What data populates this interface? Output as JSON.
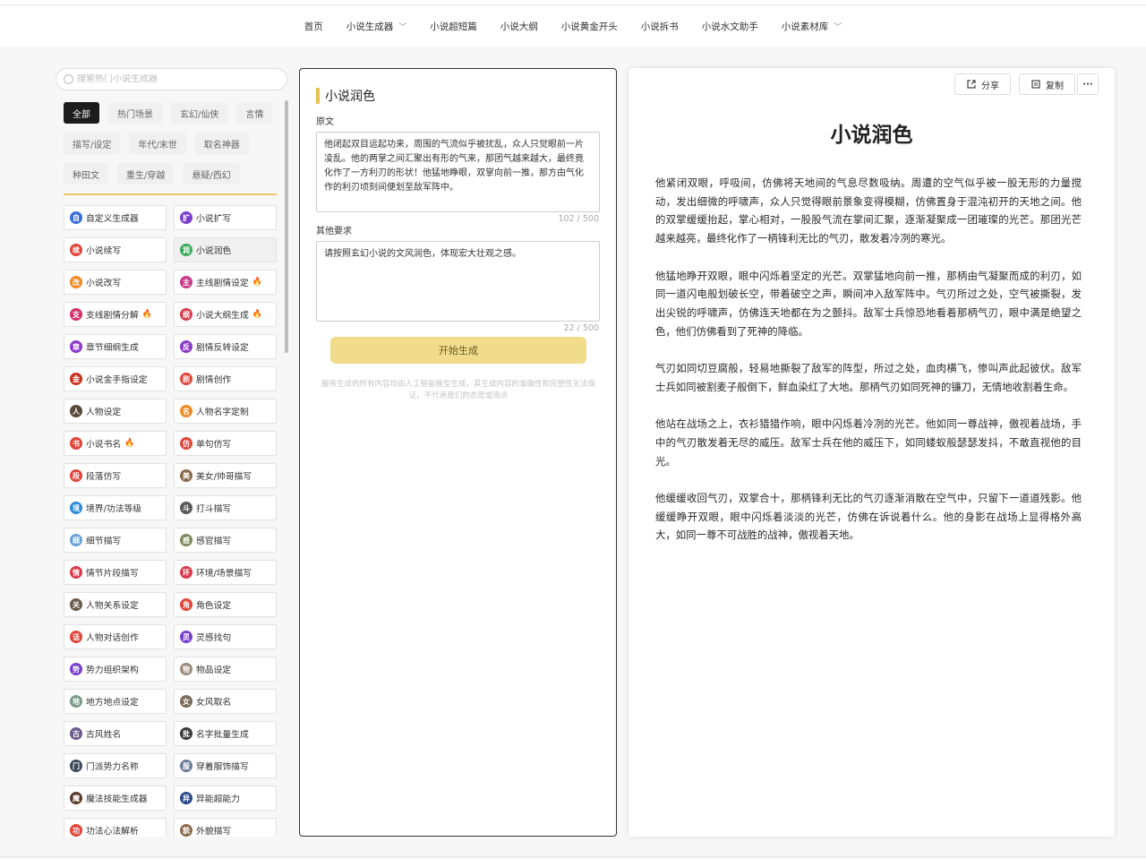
{
  "nav": {
    "items": [
      {
        "label": "首页",
        "dropdown": false
      },
      {
        "label": "小说生成器",
        "dropdown": true
      },
      {
        "label": "小说超短篇",
        "dropdown": false
      },
      {
        "label": "小说大纲",
        "dropdown": false
      },
      {
        "label": "小说黄金开头",
        "dropdown": false
      },
      {
        "label": "小说拆书",
        "dropdown": false
      },
      {
        "label": "小说水文助手",
        "dropdown": false
      },
      {
        "label": "小说素材库",
        "dropdown": true
      }
    ]
  },
  "sidebar": {
    "search_placeholder": "搜索热门小说生成器",
    "categories": [
      [
        "全部",
        "热门场景",
        "玄幻/仙侠",
        "言情"
      ],
      [
        "描写/设定",
        "年代/末世",
        "取名神器"
      ],
      [
        "种田文",
        "重生/穿越",
        "悬疑/西幻"
      ]
    ],
    "active_category": "全部",
    "accent_color": "#e6c76b",
    "tools": [
      {
        "label": "自定义生成器",
        "icon": "自",
        "color": "#3b6fd8",
        "hot": false
      },
      {
        "label": "小说扩写",
        "icon": "扩",
        "color": "#7b3fd0",
        "hot": false
      },
      {
        "label": "小说续写",
        "icon": "续",
        "color": "#e0453a",
        "hot": false
      },
      {
        "label": "小说润色",
        "icon": "润",
        "color": "#3aaa5a",
        "hot": false
      },
      {
        "label": "小说改写",
        "icon": "改",
        "color": "#f08a24",
        "hot": false
      },
      {
        "label": "主线剧情设定",
        "icon": "主",
        "color": "#c83a8a",
        "hot": true
      },
      {
        "label": "支线剧情分解",
        "icon": "支",
        "color": "#d4336b",
        "hot": true
      },
      {
        "label": "小说大纲生成",
        "icon": "纲",
        "color": "#d83a4a",
        "hot": true
      },
      {
        "label": "章节细纲生成",
        "icon": "章",
        "color": "#8e3ad0",
        "hot": false
      },
      {
        "label": "剧情反转设定",
        "icon": "反",
        "color": "#8a3ac8",
        "hot": false
      },
      {
        "label": "小说金手指设定",
        "icon": "金",
        "color": "#c8321e",
        "hot": false
      },
      {
        "label": "剧情创作",
        "icon": "剧",
        "color": "#e0453a",
        "hot": false
      },
      {
        "label": "人物设定",
        "icon": "人",
        "color": "#5a4a3a",
        "hot": false
      },
      {
        "label": "人物名字定制",
        "icon": "名",
        "color": "#f08a24",
        "hot": false
      },
      {
        "label": "小说书名",
        "icon": "书",
        "color": "#e0453a",
        "hot": true
      },
      {
        "label": "单句仿写",
        "icon": "仿",
        "color": "#e0453a",
        "hot": false
      },
      {
        "label": "段落仿写",
        "icon": "段",
        "color": "#e0453a",
        "hot": false
      },
      {
        "label": "美女/帅哥描写",
        "icon": "美",
        "color": "#8a6a4a",
        "hot": false
      },
      {
        "label": "境界/功法等级",
        "icon": "境",
        "color": "#2a8ad8",
        "hot": false
      },
      {
        "label": "打斗描写",
        "icon": "斗",
        "color": "#5a5a5a",
        "hot": false
      },
      {
        "label": "细节描写",
        "icon": "细",
        "color": "#6aa0d8",
        "hot": false
      },
      {
        "label": "感官描写",
        "icon": "感",
        "color": "#7a8a5a",
        "hot": false
      },
      {
        "label": "情节片段描写",
        "icon": "情",
        "color": "#d83a4a",
        "hot": false
      },
      {
        "label": "环境/场景描写",
        "icon": "环",
        "color": "#d83a4a",
        "hot": false
      },
      {
        "label": "人物关系设定",
        "icon": "关",
        "color": "#6a5a4a",
        "hot": false
      },
      {
        "label": "角色设定",
        "icon": "角",
        "color": "#e0453a",
        "hot": false
      },
      {
        "label": "人物对话创作",
        "icon": "话",
        "color": "#e0453a",
        "hot": false
      },
      {
        "label": "灵感找句",
        "icon": "灵",
        "color": "#7b3fd0",
        "hot": false
      },
      {
        "label": "势力组织架构",
        "icon": "势",
        "color": "#7b3fd0",
        "hot": false
      },
      {
        "label": "物品设定",
        "icon": "物",
        "color": "#9a8a7a",
        "hot": false
      },
      {
        "label": "地方地点设定",
        "icon": "地",
        "color": "#7a9a8a",
        "hot": false
      },
      {
        "label": "女风取名",
        "icon": "女",
        "color": "#7a6a5a",
        "hot": false
      },
      {
        "label": "古风姓名",
        "icon": "古",
        "color": "#6a5a8a",
        "hot": false
      },
      {
        "label": "名字批量生成",
        "icon": "批",
        "color": "#3a3a3a",
        "hot": false
      },
      {
        "label": "门派势力名称",
        "icon": "门",
        "color": "#3a4a5a",
        "hot": false
      },
      {
        "label": "穿着服饰描写",
        "icon": "服",
        "color": "#6a7a9a",
        "hot": false
      },
      {
        "label": "魔法技能生成器",
        "icon": "魔",
        "color": "#5a3a2a",
        "hot": false
      },
      {
        "label": "异能超能力",
        "icon": "异",
        "color": "#2a4a8a",
        "hot": false
      },
      {
        "label": "功法心法解析",
        "icon": "功",
        "color": "#e0453a",
        "hot": false
      },
      {
        "label": "外貌描写",
        "icon": "貌",
        "color": "#8a6a4a",
        "hot": false
      }
    ],
    "active_tool": "小说润色"
  },
  "editor": {
    "title": "小说润色",
    "original_label": "原文",
    "original_text": "他闭起双目运起功来，周围的气流似乎被扰乱，众人只觉眼前一片凌乱。他的两掌之间汇聚出有形的气来，那团气越来越大，最终竟化作了一方利刃的形状！他猛地睁眼，双掌向前一推，那方由气化作的利刃顷刻间便划至敌军阵中。",
    "original_count": "102 / 500",
    "req_label": "其他要求",
    "req_text": "请按照玄幻小说的文风润色，体现宏大壮观之感。",
    "req_count": "22 / 500",
    "generate_label": "开始生成",
    "disclaimer": "服务生成的所有内容均由人工智能模型生成，其生成内容的准确性和完整性无法保证，不代表我们的态度或观点"
  },
  "result": {
    "share_label": "分享",
    "copy_label": "复制",
    "more_label": "···",
    "title": "小说润色",
    "paragraphs": [
      "他紧闭双眼，呼吸间，仿佛将天地间的气息尽数吸纳。周遭的空气似乎被一股无形的力量搅动，发出细微的呼啸声，众人只觉得眼前景象变得模糊，仿佛置身于混沌初开的天地之间。他的双掌缓缓抬起，掌心相对，一股股气流在掌间汇聚，逐渐凝聚成一团璀璨的光芒。那团光芒越来越亮，最终化作了一柄锋利无比的气刃，散发着冷冽的寒光。",
      "他猛地睁开双眼，眼中闪烁着坚定的光芒。双掌猛地向前一推，那柄由气凝聚而成的利刃，如同一道闪电般划破长空，带着破空之声，瞬间冲入敌军阵中。气刃所过之处，空气被撕裂，发出尖锐的呼啸声，仿佛连天地都在为之颤抖。敌军士兵惊恐地看着那柄气刃，眼中满是绝望之色，他们仿佛看到了死神的降临。",
      "气刃如同切豆腐般，轻易地撕裂了敌军的阵型，所过之处，血肉横飞，惨叫声此起彼伏。敌军士兵如同被割麦子般倒下，鲜血染红了大地。那柄气刃如同死神的镰刀，无情地收割着生命。",
      "他站在战场之上，衣衫猎猎作响，眼中闪烁着冷冽的光芒。他如同一尊战神，傲视着战场，手中的气刃散发着无尽的威压。敌军士兵在他的威压下，如同蝼蚁般瑟瑟发抖，不敢直视他的目光。",
      "他缓缓收回气刃，双掌合十，那柄锋利无比的气刃逐渐消散在空气中，只留下一道道残影。他缓缓睁开双眼，眼中闪烁着淡淡的光芒，仿佛在诉说着什么。他的身影在战场上显得格外高大，如同一尊不可战胜的战神，傲视着天地。"
    ]
  }
}
